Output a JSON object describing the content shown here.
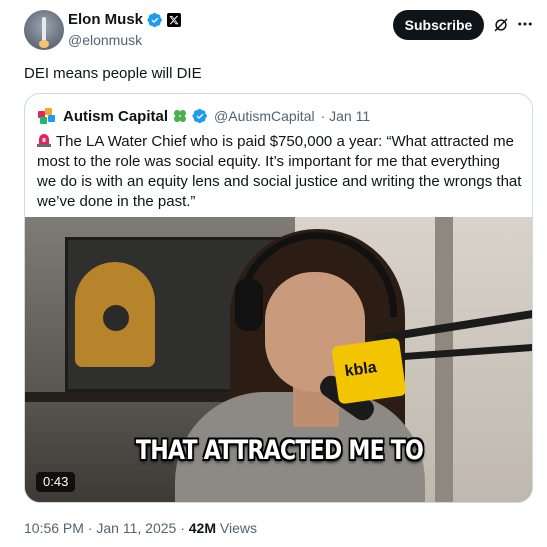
{
  "author": {
    "name": "Elon Musk",
    "handle": "@elonmusk"
  },
  "actions": {
    "subscribe_label": "Subscribe",
    "grok_icon": "grok-icon",
    "more_icon": "more-icon"
  },
  "tweet": {
    "text": "DEI means people will DIE"
  },
  "quote": {
    "name": "Autism Capital",
    "handle": "@AutismCapital",
    "date": "· Jan 11",
    "text": "The LA Water Chief who is paid $750,000 a year: “What attracted me most to the role was social equity. It’s important for me that everything we do is with an equity lens and social justice and writing the wrongs that we’ve done in the past.”",
    "video": {
      "caption": "THAT ATTRACTED ME TO",
      "duration": "0:43",
      "mic_flag_text": "kbla"
    }
  },
  "meta": {
    "time": "10:56 PM",
    "date": "Jan 11, 2025",
    "separator": "·",
    "views_count": "42M",
    "views_label": "Views"
  },
  "colors": {
    "verified_blue": "#1d9bf0",
    "secondary_text": "#536471",
    "primary_text": "#0f1419",
    "border": "#cfd9de"
  }
}
